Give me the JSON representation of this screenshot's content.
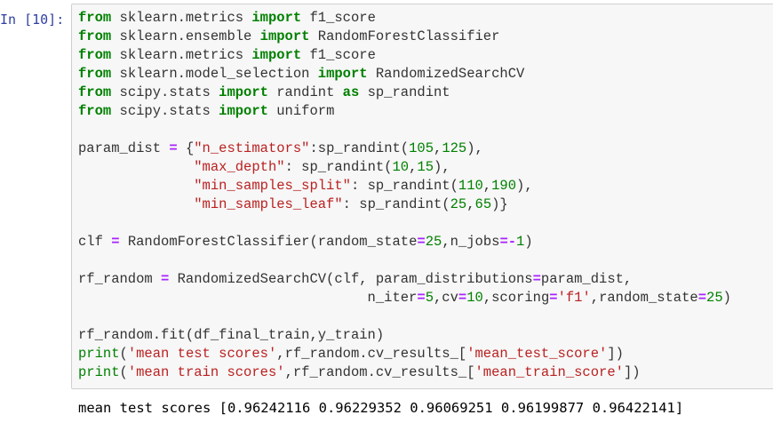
{
  "cell": {
    "prompt": "In [10]:",
    "code_lines": [
      [
        {
          "t": "from",
          "c": "kw"
        },
        {
          "t": " sklearn.metrics ",
          "c": ""
        },
        {
          "t": "import",
          "c": "kw"
        },
        {
          "t": " f1_score",
          "c": ""
        }
      ],
      [
        {
          "t": "from",
          "c": "kw"
        },
        {
          "t": " sklearn.ensemble ",
          "c": ""
        },
        {
          "t": "import",
          "c": "kw"
        },
        {
          "t": " RandomForestClassifier",
          "c": ""
        }
      ],
      [
        {
          "t": "from",
          "c": "kw"
        },
        {
          "t": " sklearn.metrics ",
          "c": ""
        },
        {
          "t": "import",
          "c": "kw"
        },
        {
          "t": " f1_score",
          "c": ""
        }
      ],
      [
        {
          "t": "from",
          "c": "kw"
        },
        {
          "t": " sklearn.model_selection ",
          "c": ""
        },
        {
          "t": "import",
          "c": "kw"
        },
        {
          "t": " RandomizedSearchCV",
          "c": ""
        }
      ],
      [
        {
          "t": "from",
          "c": "kw"
        },
        {
          "t": " scipy.stats ",
          "c": ""
        },
        {
          "t": "import",
          "c": "kw"
        },
        {
          "t": " randint ",
          "c": ""
        },
        {
          "t": "as",
          "c": "kw"
        },
        {
          "t": " sp_randint",
          "c": ""
        }
      ],
      [
        {
          "t": "from",
          "c": "kw"
        },
        {
          "t": " scipy.stats ",
          "c": ""
        },
        {
          "t": "import",
          "c": "kw"
        },
        {
          "t": " uniform",
          "c": ""
        }
      ],
      [],
      [
        {
          "t": "param_dist ",
          "c": ""
        },
        {
          "t": "=",
          "c": "op"
        },
        {
          "t": " {",
          "c": ""
        },
        {
          "t": "\"n_estimators\"",
          "c": "str"
        },
        {
          "t": ":sp_randint(",
          "c": ""
        },
        {
          "t": "105",
          "c": "num"
        },
        {
          "t": ",",
          "c": ""
        },
        {
          "t": "125",
          "c": "num"
        },
        {
          "t": "),",
          "c": ""
        }
      ],
      [
        {
          "t": "              ",
          "c": ""
        },
        {
          "t": "\"max_depth\"",
          "c": "str"
        },
        {
          "t": ": sp_randint(",
          "c": ""
        },
        {
          "t": "10",
          "c": "num"
        },
        {
          "t": ",",
          "c": ""
        },
        {
          "t": "15",
          "c": "num"
        },
        {
          "t": "),",
          "c": ""
        }
      ],
      [
        {
          "t": "              ",
          "c": ""
        },
        {
          "t": "\"min_samples_split\"",
          "c": "str"
        },
        {
          "t": ": sp_randint(",
          "c": ""
        },
        {
          "t": "110",
          "c": "num"
        },
        {
          "t": ",",
          "c": ""
        },
        {
          "t": "190",
          "c": "num"
        },
        {
          "t": "),",
          "c": ""
        }
      ],
      [
        {
          "t": "              ",
          "c": ""
        },
        {
          "t": "\"min_samples_leaf\"",
          "c": "str"
        },
        {
          "t": ": sp_randint(",
          "c": ""
        },
        {
          "t": "25",
          "c": "num"
        },
        {
          "t": ",",
          "c": ""
        },
        {
          "t": "65",
          "c": "num"
        },
        {
          "t": ")}",
          "c": ""
        }
      ],
      [],
      [
        {
          "t": "clf ",
          "c": ""
        },
        {
          "t": "=",
          "c": "op"
        },
        {
          "t": " RandomForestClassifier(random_state",
          "c": ""
        },
        {
          "t": "=",
          "c": "op"
        },
        {
          "t": "25",
          "c": "num"
        },
        {
          "t": ",n_jobs",
          "c": ""
        },
        {
          "t": "=-",
          "c": "op"
        },
        {
          "t": "1",
          "c": "num"
        },
        {
          "t": ")",
          "c": ""
        }
      ],
      [],
      [
        {
          "t": "rf_random ",
          "c": ""
        },
        {
          "t": "=",
          "c": "op"
        },
        {
          "t": " RandomizedSearchCV(clf, param_distributions",
          "c": ""
        },
        {
          "t": "=",
          "c": "op"
        },
        {
          "t": "param_dist,",
          "c": ""
        }
      ],
      [
        {
          "t": "                                   n_iter",
          "c": ""
        },
        {
          "t": "=",
          "c": "op"
        },
        {
          "t": "5",
          "c": "num"
        },
        {
          "t": ",cv",
          "c": ""
        },
        {
          "t": "=",
          "c": "op"
        },
        {
          "t": "10",
          "c": "num"
        },
        {
          "t": ",scoring",
          "c": ""
        },
        {
          "t": "=",
          "c": "op"
        },
        {
          "t": "'f1'",
          "c": "str"
        },
        {
          "t": ",random_state",
          "c": ""
        },
        {
          "t": "=",
          "c": "op"
        },
        {
          "t": "25",
          "c": "num"
        },
        {
          "t": ")",
          "c": ""
        }
      ],
      [],
      [
        {
          "t": "rf_random.fit(df_final_train,y_train)",
          "c": ""
        }
      ],
      [
        {
          "t": "print",
          "c": "num"
        },
        {
          "t": "(",
          "c": ""
        },
        {
          "t": "'mean test scores'",
          "c": "str"
        },
        {
          "t": ",rf_random.cv_results_[",
          "c": ""
        },
        {
          "t": "'mean_test_score'",
          "c": "str"
        },
        {
          "t": "])",
          "c": ""
        }
      ],
      [
        {
          "t": "print",
          "c": "num"
        },
        {
          "t": "(",
          "c": ""
        },
        {
          "t": "'mean train scores'",
          "c": "str"
        },
        {
          "t": ",rf_random.cv_results_[",
          "c": ""
        },
        {
          "t": "'mean_train_score'",
          "c": "str"
        },
        {
          "t": "])",
          "c": ""
        }
      ]
    ],
    "output": "mean test scores [0.96242116 0.96229352 0.96069251 0.96199877 0.96422141]"
  }
}
